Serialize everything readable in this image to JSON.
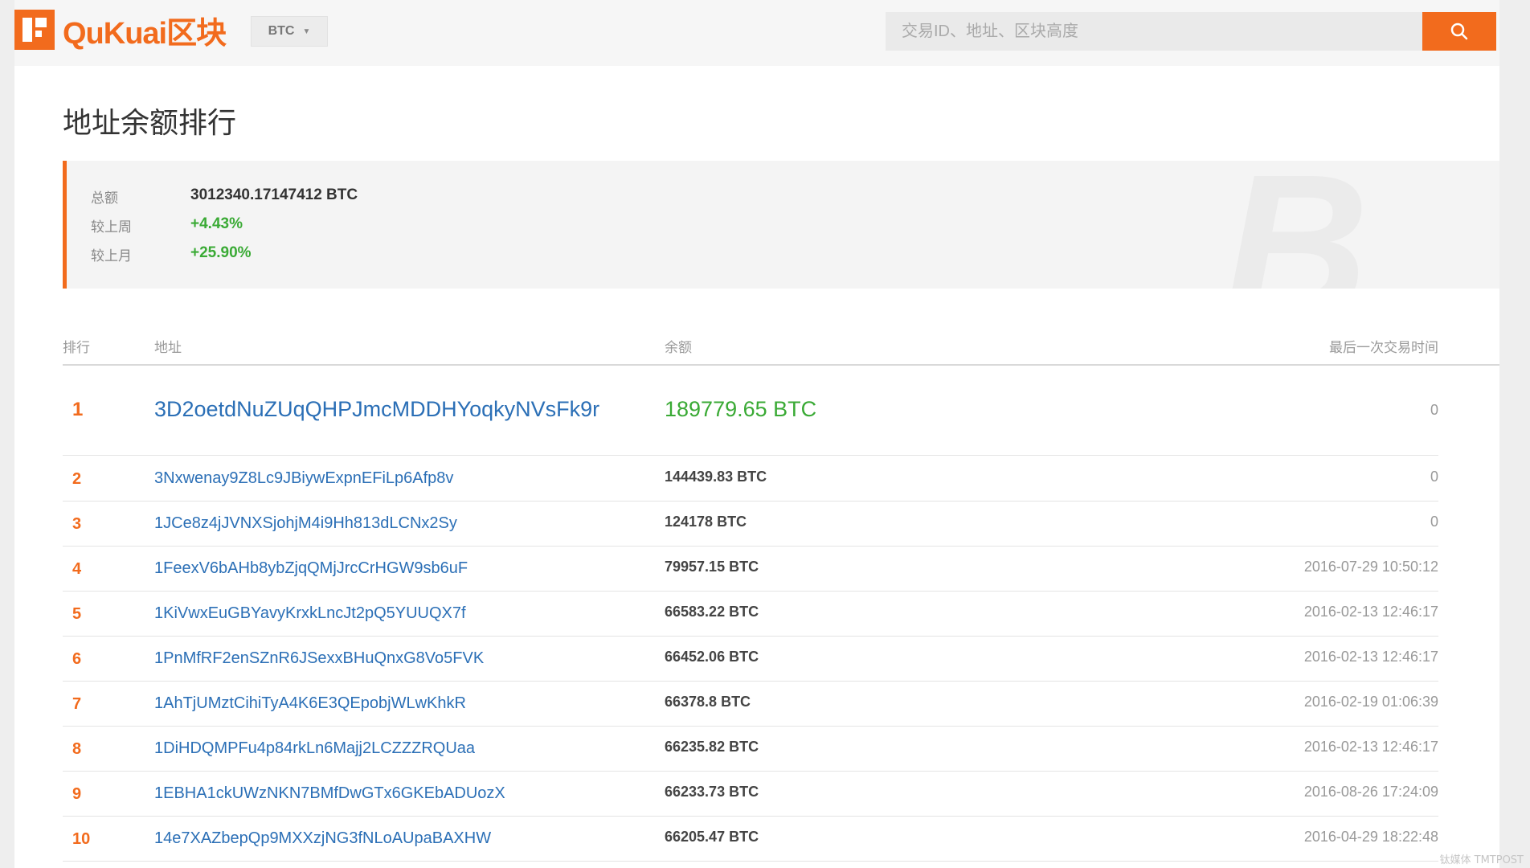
{
  "header": {
    "brand": "QuKuai区块",
    "coin_selector": "BTC",
    "search_placeholder": "交易ID、地址、区块高度"
  },
  "page_title": "地址余额排行",
  "summary": {
    "total_label": "总额",
    "total_value": "3012340.17147412 BTC",
    "week_label": "较上周",
    "week_value": "+4.43%",
    "month_label": "较上月",
    "month_value": "+25.90%"
  },
  "table": {
    "headers": {
      "rank": "排行",
      "address": "地址",
      "balance": "余额",
      "last_tx": "最后一次交易时间"
    },
    "rows": [
      {
        "rank": "1",
        "address": "3D2oetdNuZUqQHPJmcMDDHYoqkyNVsFk9r",
        "balance": "189779.65 BTC",
        "last_tx": "0"
      },
      {
        "rank": "2",
        "address": "3Nxwenay9Z8Lc9JBiywExpnEFiLp6Afp8v",
        "balance": "144439.83 BTC",
        "last_tx": "0"
      },
      {
        "rank": "3",
        "address": "1JCe8z4jJVNXSjohjM4i9Hh813dLCNx2Sy",
        "balance": "124178 BTC",
        "last_tx": "0"
      },
      {
        "rank": "4",
        "address": "1FeexV6bAHb8ybZjqQMjJrcCrHGW9sb6uF",
        "balance": "79957.15 BTC",
        "last_tx": "2016-07-29 10:50:12"
      },
      {
        "rank": "5",
        "address": "1KiVwxEuGBYavyKrxkLncJt2pQ5YUUQX7f",
        "balance": "66583.22 BTC",
        "last_tx": "2016-02-13 12:46:17"
      },
      {
        "rank": "6",
        "address": "1PnMfRF2enSZnR6JSexxBHuQnxG8Vo5FVK",
        "balance": "66452.06 BTC",
        "last_tx": "2016-02-13 12:46:17"
      },
      {
        "rank": "7",
        "address": "1AhTjUMztCihiTyA4K6E3QEpobjWLwKhkR",
        "balance": "66378.8 BTC",
        "last_tx": "2016-02-19 01:06:39"
      },
      {
        "rank": "8",
        "address": "1DiHDQMPFu4p84rkLn6Majj2LCZZZRQUaa",
        "balance": "66235.82 BTC",
        "last_tx": "2016-02-13 12:46:17"
      },
      {
        "rank": "9",
        "address": "1EBHA1ckUWzNKN7BMfDwGTx6GKEbADUozX",
        "balance": "66233.73 BTC",
        "last_tx": "2016-08-26 17:24:09"
      },
      {
        "rank": "10",
        "address": "14e7XAZbepQp9MXXzjNG3fNLoAUpaBAXHW",
        "balance": "66205.47 BTC",
        "last_tx": "2016-04-29 18:22:48"
      }
    ]
  },
  "watermark": "钛媒体 TMTPOST",
  "colors": {
    "accent": "#f26b1d",
    "link": "#2b6fb6",
    "positive": "#3aaa35"
  }
}
